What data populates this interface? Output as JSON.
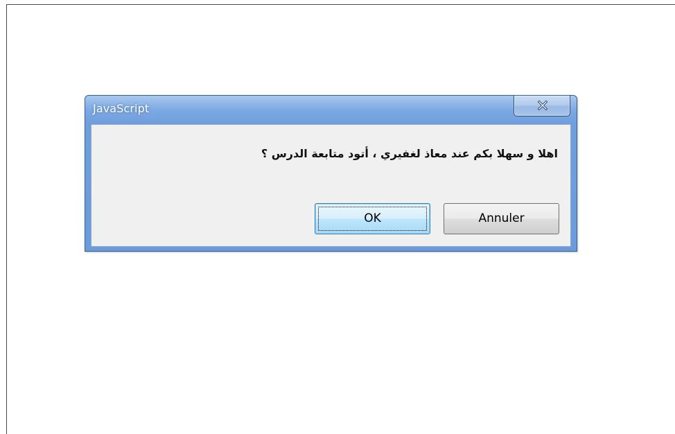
{
  "dialog": {
    "title": "JavaScript",
    "message": "اهلا و سهلا بكم عند معاذ لغفيري ، أتود متابعة الدرس ؟",
    "close_icon": "close-icon",
    "buttons": {
      "ok_label": "OK",
      "cancel_label": "Annuler"
    }
  },
  "colors": {
    "frame_blue": "#6c9bdb",
    "client_background": "#f0f0f0",
    "ok_button_border": "#3c7fb1"
  }
}
